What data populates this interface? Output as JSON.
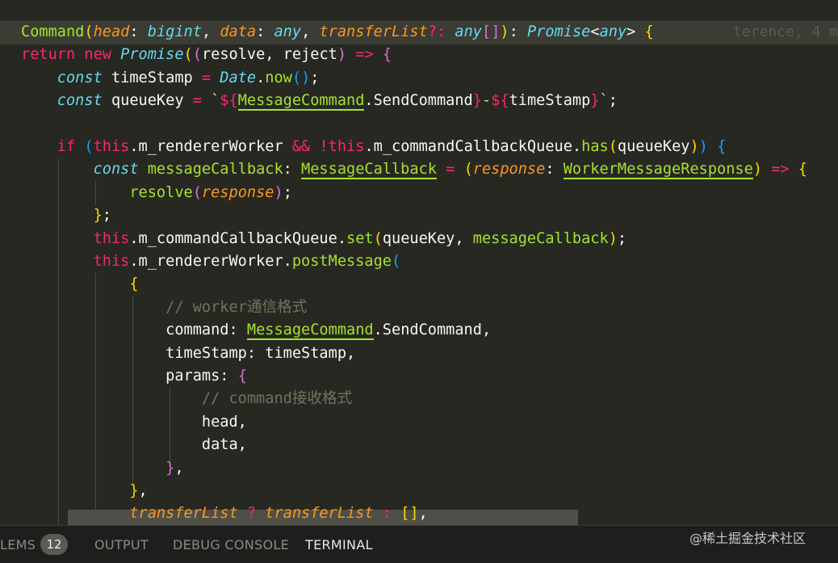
{
  "editor": {
    "blame": "terence, 4 m",
    "lines": [
      [
        [
          "Command",
          "t-fn"
        ],
        [
          "(",
          "t-br1"
        ],
        [
          "head",
          "t-arg"
        ],
        [
          ": ",
          "t-pun"
        ],
        [
          "bigint",
          "t-cls"
        ],
        [
          ", ",
          "t-pun"
        ],
        [
          "data",
          "t-arg"
        ],
        [
          ": ",
          "t-pun"
        ],
        [
          "any",
          "t-cls"
        ],
        [
          ", ",
          "t-pun"
        ],
        [
          "transferList",
          "t-arg"
        ],
        [
          "?: ",
          "t-kw"
        ],
        [
          "any",
          "t-cls"
        ],
        [
          "[]",
          "t-br2"
        ],
        [
          ")",
          "t-br1"
        ],
        [
          ": ",
          "t-pun"
        ],
        [
          "Promise",
          "t-cls"
        ],
        [
          "<",
          "t-pun"
        ],
        [
          "any",
          "t-cls"
        ],
        [
          "> ",
          "t-pun"
        ],
        [
          "{",
          "t-br1"
        ]
      ],
      [
        [
          "return ",
          "t-kw"
        ],
        [
          "new ",
          "t-kw"
        ],
        [
          "Promise",
          "t-cls"
        ],
        [
          "(",
          "t-br1"
        ],
        [
          "(",
          "t-br2"
        ],
        [
          "resolve, reject",
          "t-def"
        ],
        [
          ")",
          "t-br2"
        ],
        [
          " => ",
          "t-kw"
        ],
        [
          "{",
          "t-br2"
        ]
      ],
      [
        [
          "    ",
          "t-def"
        ],
        [
          "const ",
          "t-cls"
        ],
        [
          "timeStamp ",
          "t-def"
        ],
        [
          "= ",
          "t-kw"
        ],
        [
          "Date",
          "t-cls"
        ],
        [
          ".",
          "t-pun"
        ],
        [
          "now",
          "t-fn"
        ],
        [
          "()",
          "t-br3"
        ],
        [
          ";",
          "t-pun"
        ]
      ],
      [
        [
          "    ",
          "t-def"
        ],
        [
          "const ",
          "t-cls"
        ],
        [
          "queueKey ",
          "t-def"
        ],
        [
          "= ",
          "t-kw"
        ],
        [
          "`",
          "t-tpl"
        ],
        [
          "${",
          "t-kw"
        ],
        [
          "MessageCommand",
          "t-u"
        ],
        [
          ".SendCommand",
          "t-def"
        ],
        [
          "}",
          "t-kw"
        ],
        [
          "-",
          "t-tpl"
        ],
        [
          "${",
          "t-kw"
        ],
        [
          "timeStamp",
          "t-def"
        ],
        [
          "}",
          "t-kw"
        ],
        [
          "`",
          "t-tpl"
        ],
        [
          ";",
          "t-pun"
        ]
      ],
      [],
      [
        [
          "    ",
          "t-def"
        ],
        [
          "if ",
          "t-kw"
        ],
        [
          "(",
          "t-br3"
        ],
        [
          "this",
          "t-kw"
        ],
        [
          ".m_rendererWorker ",
          "t-def"
        ],
        [
          "&& ",
          "t-kw"
        ],
        [
          "!",
          "t-kw"
        ],
        [
          "this",
          "t-kw"
        ],
        [
          ".m_commandCallbackQueue.",
          "t-def"
        ],
        [
          "has",
          "t-fn"
        ],
        [
          "(",
          "t-br1"
        ],
        [
          "queueKey",
          "t-def"
        ],
        [
          ")",
          "t-br1"
        ],
        [
          ") ",
          "t-br3"
        ],
        [
          "{",
          "t-br3"
        ]
      ],
      [
        [
          "        ",
          "t-def"
        ],
        [
          "const ",
          "t-cls"
        ],
        [
          "messageCallback",
          "t-fn"
        ],
        [
          ": ",
          "t-pun"
        ],
        [
          "MessageCallback",
          "t-u"
        ],
        [
          " = ",
          "t-kw"
        ],
        [
          "(",
          "t-br1"
        ],
        [
          "response",
          "t-arg"
        ],
        [
          ": ",
          "t-pun"
        ],
        [
          "WorkerMessageResponse",
          "t-u"
        ],
        [
          ")",
          "t-br1"
        ],
        [
          " => ",
          "t-kw"
        ],
        [
          "{",
          "t-br1"
        ]
      ],
      [
        [
          "            ",
          "t-def"
        ],
        [
          "resolve",
          "t-fn"
        ],
        [
          "(",
          "t-br2"
        ],
        [
          "response",
          "t-arg"
        ],
        [
          ")",
          "t-br2"
        ],
        [
          ";",
          "t-pun"
        ]
      ],
      [
        [
          "        ",
          "t-def"
        ],
        [
          "}",
          "t-br1"
        ],
        [
          ";",
          "t-pun"
        ]
      ],
      [
        [
          "        ",
          "t-def"
        ],
        [
          "this",
          "t-kw"
        ],
        [
          ".m_commandCallbackQueue.",
          "t-def"
        ],
        [
          "set",
          "t-fn"
        ],
        [
          "(",
          "t-br1"
        ],
        [
          "queueKey, ",
          "t-def"
        ],
        [
          "messageCallback",
          "t-fn"
        ],
        [
          ")",
          "t-br1"
        ],
        [
          ";",
          "t-pun"
        ]
      ],
      [
        [
          "        ",
          "t-def"
        ],
        [
          "this",
          "t-kw"
        ],
        [
          ".m_rendererWorker.",
          "t-def"
        ],
        [
          "postMessage",
          "t-fn"
        ],
        [
          "(",
          "t-br3"
        ]
      ],
      [
        [
          "            ",
          "t-def"
        ],
        [
          "{",
          "t-br1"
        ]
      ],
      [
        [
          "                ",
          "t-def"
        ],
        [
          "// worker通信格式",
          "t-cmt"
        ]
      ],
      [
        [
          "                ",
          "t-def"
        ],
        [
          "command: ",
          "t-def"
        ],
        [
          "MessageCommand",
          "t-u"
        ],
        [
          ".SendCommand,",
          "t-def"
        ]
      ],
      [
        [
          "                ",
          "t-def"
        ],
        [
          "timeStamp: timeStamp,",
          "t-def"
        ]
      ],
      [
        [
          "                ",
          "t-def"
        ],
        [
          "params: ",
          "t-def"
        ],
        [
          "{",
          "t-br2"
        ]
      ],
      [
        [
          "                    ",
          "t-def"
        ],
        [
          "// command接收格式",
          "t-cmt"
        ]
      ],
      [
        [
          "                    ",
          "t-def"
        ],
        [
          "head,",
          "t-def"
        ]
      ],
      [
        [
          "                    ",
          "t-def"
        ],
        [
          "data,",
          "t-def"
        ]
      ],
      [
        [
          "                ",
          "t-def"
        ],
        [
          "}",
          "t-br2"
        ],
        [
          ",",
          "t-pun"
        ]
      ],
      [
        [
          "            ",
          "t-def"
        ],
        [
          "}",
          "t-br1"
        ],
        [
          ",",
          "t-pun"
        ]
      ],
      [
        [
          "            ",
          "t-def"
        ],
        [
          "transferList ",
          "t-arg"
        ],
        [
          "? ",
          "t-kw"
        ],
        [
          "transferList ",
          "t-arg"
        ],
        [
          ": ",
          "t-kw"
        ],
        [
          "[]",
          "t-br1"
        ],
        [
          ",",
          "t-pun"
        ]
      ]
    ]
  },
  "panel": {
    "tabs": [
      "LEMS",
      "OUTPUT",
      "DEBUG CONSOLE",
      "TERMINAL"
    ],
    "badge": "12",
    "active_tab": "TERMINAL"
  },
  "watermark": "@稀土掘金技术社区"
}
